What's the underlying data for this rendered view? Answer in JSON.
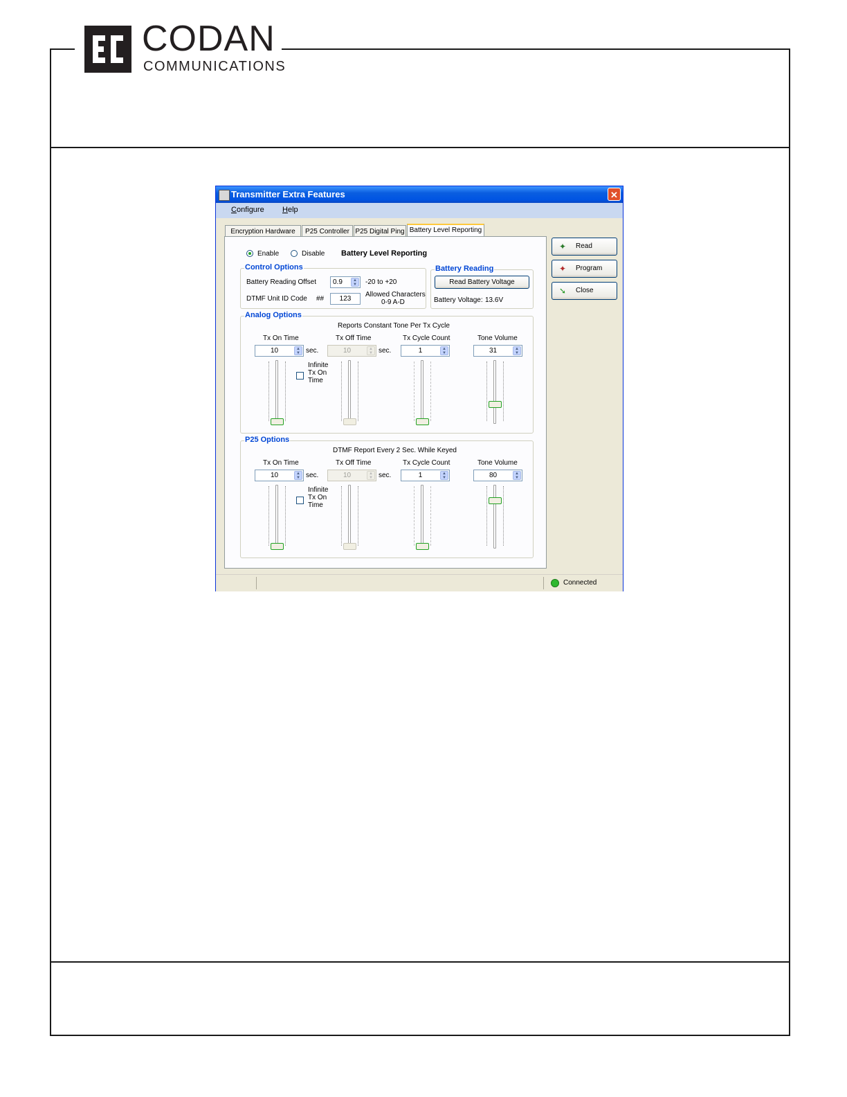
{
  "logo": {
    "name": "CODAN",
    "sub": "COMMUNICATIONS"
  },
  "window": {
    "title": "Transmitter Extra Features",
    "menu": [
      {
        "accel": "C",
        "rest": "onfigure"
      },
      {
        "accel": "H",
        "rest": "elp"
      }
    ],
    "tabs": [
      "Encryption Hardware",
      "P25 Controller",
      "P25 Digital Ping",
      "Battery Level Reporting"
    ],
    "enable_label": "Enable",
    "disable_label": "Disable",
    "feature_title": "Battery Level Reporting",
    "control": {
      "title": "Control Options",
      "offset_label": "Battery Reading Offset",
      "offset_value": "0.9",
      "offset_range": "-20 to +20",
      "dtmf_label": "DTMF Unit ID Code",
      "dtmf_prefix": "##",
      "dtmf_value": "123",
      "allowed_line1": "Allowed Characters",
      "allowed_line2": "0-9 A-D"
    },
    "battery": {
      "title": "Battery Reading",
      "read_button": "Read Battery Voltage",
      "voltage_label": "Battery Voltage:",
      "voltage_value": "13.6V"
    },
    "analog": {
      "title": "Analog Options",
      "subtitle": "Reports Constant Tone Per Tx Cycle",
      "tx_on_label": "Tx On Time",
      "tx_on_value": "10",
      "tx_off_label": "Tx Off Time",
      "tx_off_value": "10",
      "cycle_label": "Tx Cycle Count",
      "cycle_value": "1",
      "volume_label": "Tone Volume",
      "volume_value": "31",
      "sec": "sec.",
      "infinite": [
        "Infinite",
        "Tx On",
        "Time"
      ],
      "slider_levels": {
        "tx_on": 0.0,
        "tx_off": 0.0,
        "cycle": 0.0,
        "volume": 0.31
      }
    },
    "p25": {
      "title": "P25 Options",
      "subtitle": "DTMF Report Every 2 Sec. While Keyed",
      "tx_on_label": "Tx On Time",
      "tx_on_value": "10",
      "tx_off_label": "Tx Off Time",
      "tx_off_value": "10",
      "cycle_label": "Tx Cycle Count",
      "cycle_value": "1",
      "volume_label": "Tone Volume",
      "volume_value": "80",
      "sec": "sec.",
      "infinite": [
        "Infinite",
        "Tx On",
        "Time"
      ],
      "slider_levels": {
        "tx_on": 0.0,
        "tx_off": 0.0,
        "cycle": 0.0,
        "volume": 0.8
      }
    },
    "buttons": {
      "read": "Read",
      "program": "Program",
      "close": "Close"
    },
    "status": "Connected"
  }
}
